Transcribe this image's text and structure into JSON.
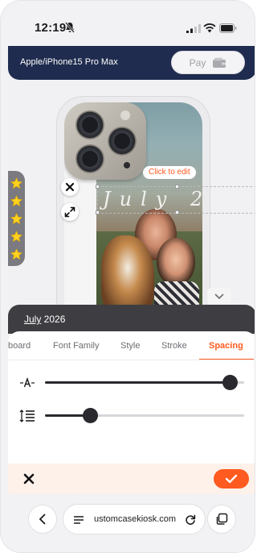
{
  "status_bar": {
    "time": "12:19"
  },
  "header": {
    "model": "Apple/iPhone15 Pro Max",
    "pay_label": "Pay"
  },
  "canvas": {
    "overlay_text": "July 2",
    "edit_hint": "Click to edit"
  },
  "rating": {
    "stars": 5
  },
  "editor": {
    "text_preview_first": "July",
    "text_preview_rest": " 2026",
    "tabs": [
      {
        "label": "board"
      },
      {
        "label": "Font Family"
      },
      {
        "label": "Style"
      },
      {
        "label": "Stroke"
      },
      {
        "label": "Spacing",
        "active": true
      }
    ],
    "letter_spacing_level": 0.93,
    "line_spacing_level": 0.23
  },
  "browser": {
    "url": "ustomcasekiosk.com"
  },
  "colors": {
    "accent": "#ff5a1f",
    "header_bg": "#1f2c4f",
    "star": "#ffd21f"
  },
  "icons": [
    "bell-slash-icon",
    "signal-icon",
    "wifi-icon",
    "battery-icon",
    "wallet-icon",
    "close-icon",
    "expand-icon",
    "chevron-down-icon",
    "star-icon",
    "letter-spacing-icon",
    "line-spacing-icon",
    "check-icon",
    "chevron-left-icon",
    "reader-icon",
    "reload-icon",
    "tabs-icon"
  ]
}
